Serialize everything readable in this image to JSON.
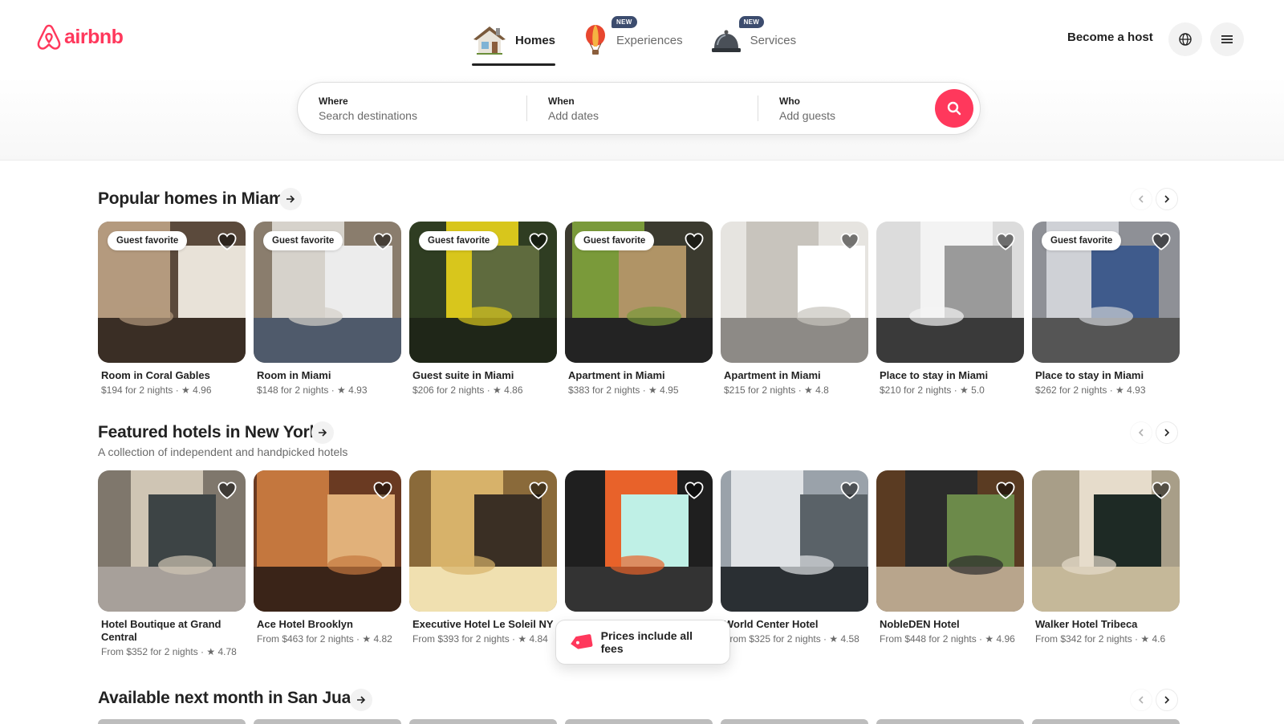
{
  "brand": {
    "name": "airbnb",
    "color": "#ff385c"
  },
  "nav": {
    "tabs": [
      {
        "label": "Homes",
        "icon": "house-icon",
        "badge": ""
      },
      {
        "label": "Experiences",
        "icon": "hot-air-balloon-icon",
        "badge": "NEW"
      },
      {
        "label": "Services",
        "icon": "service-bell-icon",
        "badge": "NEW"
      }
    ],
    "become_host": "Become a host",
    "globe_icon": "globe-icon",
    "menu_icon": "hamburger-menu-icon"
  },
  "search": {
    "where_title": "Where",
    "where_placeholder": "Search destinations",
    "when_title": "When",
    "when_placeholder": "Add dates",
    "who_title": "Who",
    "who_placeholder": "Add guests",
    "button_icon": "search-icon"
  },
  "sections": [
    {
      "title": "Popular homes in Miami",
      "subtitle": "",
      "cards": [
        {
          "title": "Room in Coral Gables",
          "meta": "$194 for 2 nights · ★ 4.96",
          "badge": "Guest favorite"
        },
        {
          "title": "Room in Miami",
          "meta": "$148 for 2 nights · ★ 4.93",
          "badge": "Guest favorite"
        },
        {
          "title": "Guest suite in Miami",
          "meta": "$206 for 2 nights · ★ 4.86",
          "badge": "Guest favorite"
        },
        {
          "title": "Apartment in Miami",
          "meta": "$383 for 2 nights · ★ 4.95",
          "badge": "Guest favorite"
        },
        {
          "title": "Apartment in Miami",
          "meta": "$215 for 2 nights · ★ 4.8",
          "badge": ""
        },
        {
          "title": "Place to stay in Miami",
          "meta": "$210 for 2 nights · ★ 5.0",
          "badge": ""
        },
        {
          "title": "Place to stay in Miami",
          "meta": "$262 for 2 nights · ★ 4.93",
          "badge": "Guest favorite"
        }
      ]
    },
    {
      "title": "Featured hotels in New York",
      "subtitle": "A collection of independent and handpicked hotels",
      "cards": [
        {
          "title": "Hotel Boutique at Grand Central",
          "meta": "From $352 for 2 nights · ★ 4.78",
          "badge": ""
        },
        {
          "title": "Ace Hotel Brooklyn",
          "meta": "From $463 for 2 nights · ★ 4.82",
          "badge": ""
        },
        {
          "title": "Executive Hotel Le Soleil NY",
          "meta": "From $393 for 2 nights · ★ 4.84",
          "badge": ""
        },
        {
          "title": "",
          "meta": "",
          "badge": ""
        },
        {
          "title": "World Center Hotel",
          "meta": "From $325 for 2 nights · ★ 4.58",
          "badge": ""
        },
        {
          "title": "NobleDEN Hotel",
          "meta": "From $448 for 2 nights · ★ 4.96",
          "badge": ""
        },
        {
          "title": "Walker Hotel Tribeca",
          "meta": "From $342 for 2 nights · ★ 4.6",
          "badge": ""
        }
      ]
    },
    {
      "title": "Available next month in San Juan",
      "subtitle": "",
      "cards": []
    }
  ],
  "toast": {
    "text": "Prices include all fees",
    "icon": "price-tag-icon"
  }
}
